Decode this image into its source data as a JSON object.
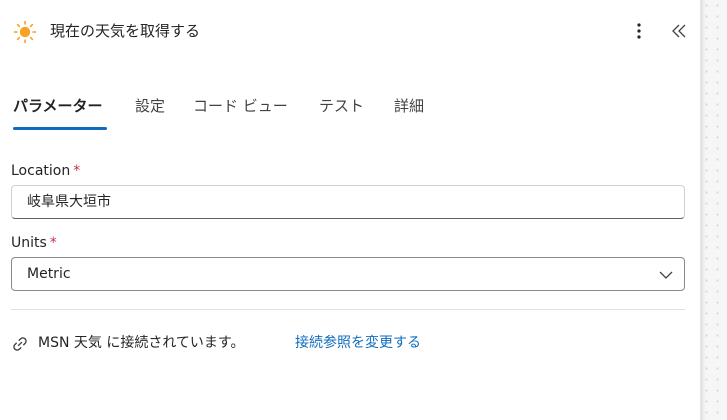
{
  "header": {
    "title": "現在の天気を取得する",
    "icon": "sun-icon",
    "more_icon": "more-vertical-icon",
    "collapse_icon": "double-chevron-left-icon"
  },
  "tabs": [
    {
      "label": "パラメーター",
      "active": true
    },
    {
      "label": "設定",
      "active": false
    },
    {
      "label": "コード ビュー",
      "active": false
    },
    {
      "label": "テスト",
      "active": false
    },
    {
      "label": "詳細",
      "active": false
    }
  ],
  "fields": {
    "location": {
      "label": "Location",
      "required_mark": "*",
      "value": "岐阜県大垣市"
    },
    "units": {
      "label": "Units",
      "required_mark": "*",
      "value": "Metric"
    }
  },
  "connection": {
    "icon": "link-icon",
    "text": "MSN 天気 に接続されています。",
    "change_link": "接続参照を変更する"
  },
  "colors": {
    "accent": "#0f6cbd",
    "required": "#c4314b",
    "sun": "#f7a125"
  }
}
